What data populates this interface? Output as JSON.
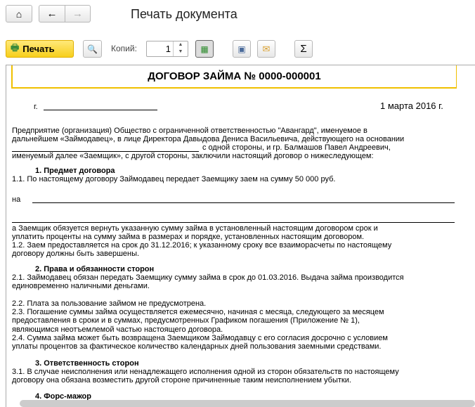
{
  "header": {
    "title": "Печать документа"
  },
  "toolbar": {
    "print_label": "Печать",
    "copies_label": "Копий:",
    "copies_value": "1"
  },
  "document": {
    "title": "ДОГОВОР ЗАЙМА № 0000-000001",
    "city_prefix": "г.",
    "date": "1 марта 2016 г.",
    "lines": [
      "Предприятие (организация) Общество с ограниченной ответственностью \"Авангард\", именуемое в",
      "дальнейшем «Займодавец», в лице Директора Давыдова Дениса Васильевича, действующего на основании",
      "с одной стороны, и гр. Балмашов Павел Андреевич,",
      "именуемый далее «Заемщик», с другой стороны, заключили настоящий договор о нижеследующем:",
      "1. Предмет договора",
      "1.1. По настоящему договору Займодавец передает Заемщику заем на сумму 50 000 руб.",
      "на",
      "а Заемщик обязуется вернуть указанную сумму займа в установленный настоящим договором срок и",
      "уплатить проценты на сумму займа в размерах и порядке, установленных настоящим договором.",
      "1.2. Заем предоставляется на срок до 31.12.2016; к указанному сроку все взаиморасчеты по настоящему",
      "договору должны быть завершены.",
      "2. Права и обязанности сторон",
      "2.1. Займодавец обязан передать Заемщику сумму займа в срок до 01.03.2016. Выдача займа производится",
      "единовременно наличными деньгами.",
      "2.2. Плата за пользование займом не предусмотрена.",
      "2.3. Погашение суммы займа осуществляется ежемесячно, начиная с месяца, следующего за месяцем",
      "предоставления в сроки и в суммах, предусмотренных Графиком погашения (Приложение № 1),",
      "являющимся неотъемлемой частью настоящего договора.",
      "2.4. Сумма займа может быть возвращена Заемщиком Займодавцу с его согласия досрочно с условием",
      "уплаты процентов за фактическое количество календарных дней пользования заемными средствами.",
      "3. Ответственность сторон",
      "3.1. В случае неисполнения или ненадлежащего исполнения одной из сторон обязательств по настоящему",
      "договору она обязана возместить другой стороне причиненные таким неисполнением убытки.",
      "4. Форс-мажор"
    ]
  }
}
